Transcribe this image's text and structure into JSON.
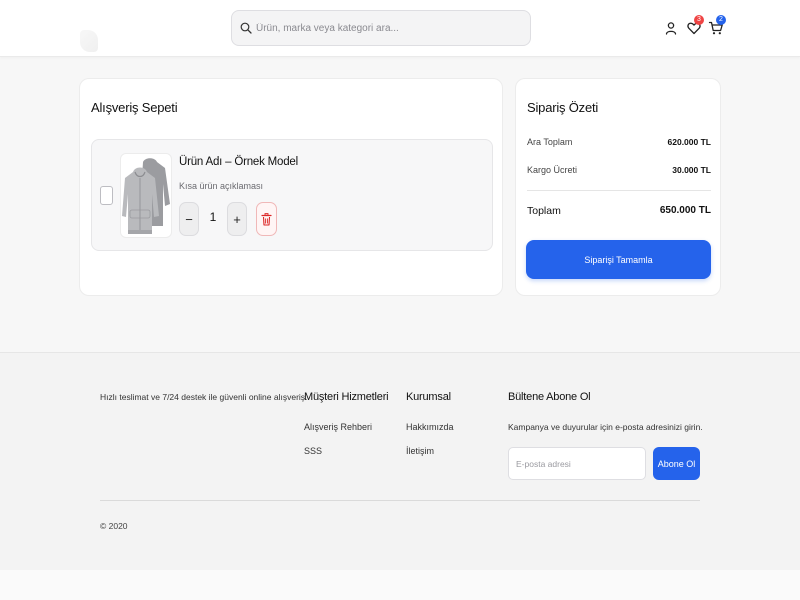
{
  "header": {
    "search_placeholder": "Ürün, marka veya kategori ara...",
    "icons": [
      "search-icon",
      "user-icon",
      "heart-icon",
      "cart-icon"
    ],
    "wishlist_count": "3",
    "cart_count": "2",
    "wishlist_badge_color": "#ef4444",
    "cart_badge_color": "#2563eb"
  },
  "cart": {
    "title": "Alışveriş Sepeti",
    "item": {
      "name": "Ürün Adı – Örnek Model",
      "description": "Kısa ürün açıklaması",
      "quantity": "1",
      "decrease_label": "−",
      "increase_label": "+"
    }
  },
  "summary": {
    "title": "Sipariş Özeti",
    "subtotal_label": "Ara Toplam",
    "subtotal_value": "620.000 TL",
    "shipping_label": "Kargo Ücreti",
    "shipping_value": "30.000 TL",
    "total_label": "Toplam",
    "total_value": "650.000 TL",
    "checkout_label": "Siparişi Tamamla"
  },
  "footer": {
    "about": "Hızlı teslimat ve 7/24 destek ile güvenli online alışveriş.",
    "customer_service": {
      "title": "Müşteri Hizmetleri",
      "links": [
        "Alışveriş Rehberi",
        "SSS"
      ]
    },
    "corporate": {
      "title": "Kurumsal",
      "links": [
        "Hakkımızda",
        "İletişim"
      ]
    },
    "newsletter": {
      "title": "Bültene Abone Ol",
      "text": "Kampanya ve duyurular için e-posta adresinizi girin.",
      "email_placeholder": "E-posta adresi",
      "subscribe_label": "Abone Ol"
    },
    "copyright": "© 2020"
  },
  "colors": {
    "accent": "#2563eb",
    "danger": "#ef4444"
  }
}
